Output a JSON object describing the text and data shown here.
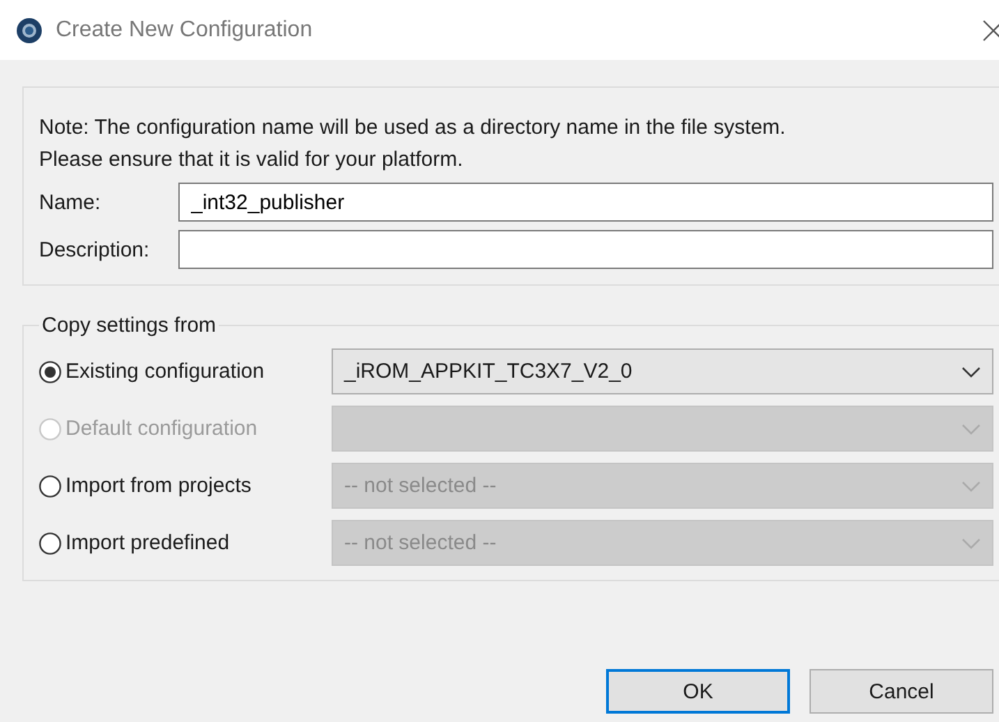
{
  "window": {
    "title": "Create New Configuration"
  },
  "note": [
    "Note: The configuration name will be used as a directory name in the file system.",
    "Please ensure that it is valid for your platform."
  ],
  "fields": [
    {
      "label": "Name:",
      "value": "_int32_publisher"
    },
    {
      "label": "Description:"
    }
  ],
  "copy_settings": {
    "title": "Copy settings from",
    "options": [
      {
        "label": "Existing configuration",
        "selected": true,
        "disabled": false,
        "dropdown": {
          "value": "_iROM_APPKIT_TC3X7_V2_0",
          "disabled": false
        }
      },
      {
        "label": "Default configuration",
        "selected": false,
        "disabled": true,
        "dropdown": {
          "disabled": true
        }
      },
      {
        "label": "Import from projects",
        "selected": false,
        "disabled": false,
        "dropdown": {
          "value": "-- not selected --",
          "disabled": true
        }
      },
      {
        "label": "Import predefined",
        "selected": false,
        "disabled": false,
        "dropdown": {
          "value": "-- not selected --",
          "disabled": true
        }
      }
    ]
  },
  "buttons": [
    {
      "label": "OK",
      "default": true
    },
    {
      "label": "Cancel",
      "default": false
    }
  ]
}
